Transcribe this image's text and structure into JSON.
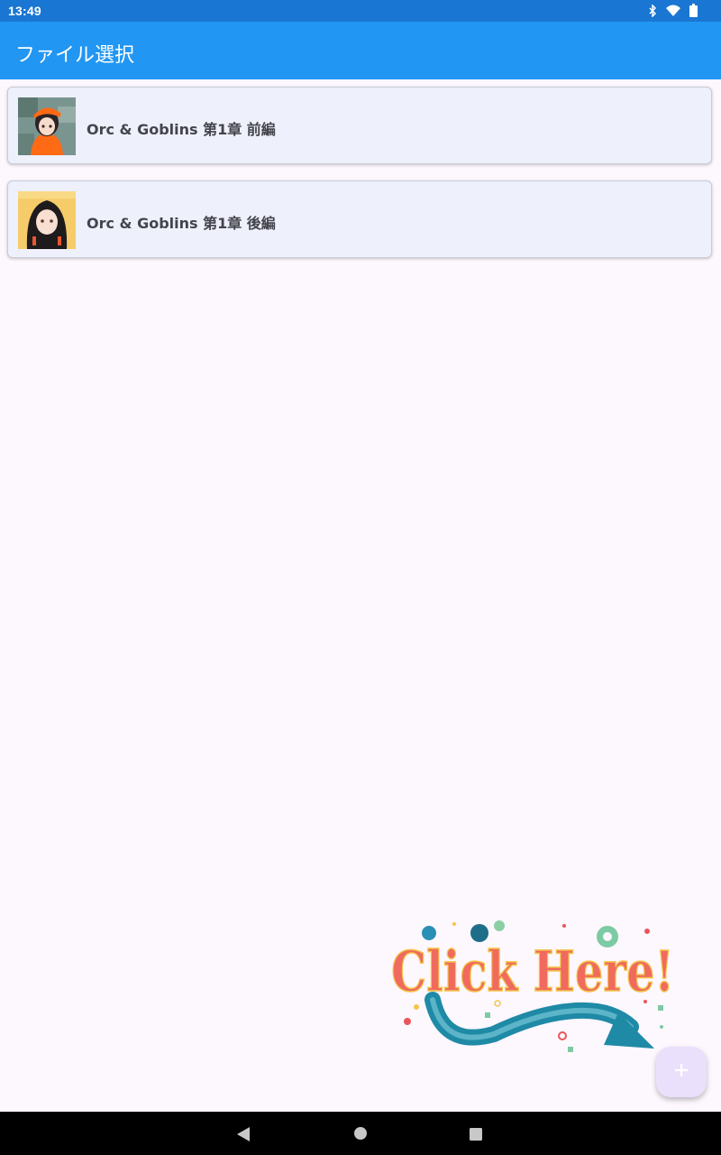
{
  "status_bar": {
    "time": "13:49",
    "icons": [
      "bluetooth-icon",
      "wifi-icon",
      "battery-icon"
    ]
  },
  "app_bar": {
    "title": "ファイル選択"
  },
  "files": [
    {
      "title": "Orc & Goblins 第1章 前編",
      "thumbnail": "orange-beret-girl-avatar"
    },
    {
      "title": "Orc & Goblins 第1章 後編",
      "thumbnail": "black-hair-girl-avatar"
    }
  ],
  "promo": {
    "text": "Click Here!"
  },
  "fab": {
    "icon": "plus-icon"
  },
  "nav_bar": {
    "icons": [
      "back-icon",
      "home-icon",
      "recents-icon"
    ]
  },
  "colors": {
    "status_bar": "#1976d2",
    "app_bar": "#2196f3",
    "background": "#fdf7fe",
    "card": "#eef0fb",
    "fab": "#ebe0fb"
  }
}
